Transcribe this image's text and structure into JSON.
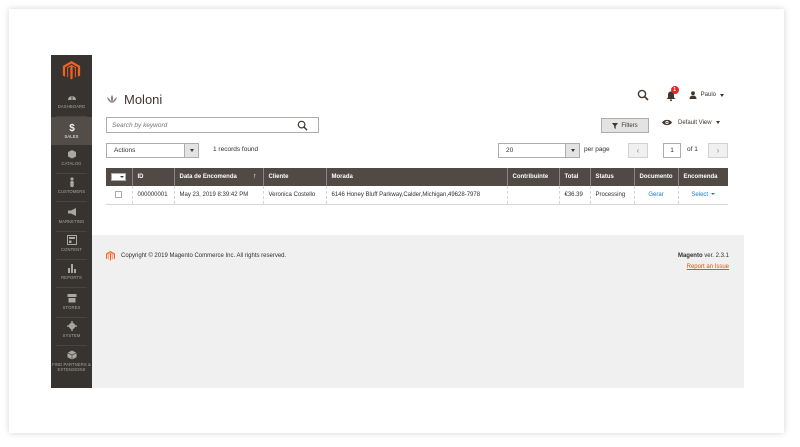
{
  "nav": [
    {
      "label": "DASHBOARD",
      "icon": "dashboard-icon"
    },
    {
      "label": "SALES",
      "icon": "dollar-icon"
    },
    {
      "label": "CATALOG",
      "icon": "cube-icon"
    },
    {
      "label": "CUSTOMERS",
      "icon": "person-icon"
    },
    {
      "label": "MARKETING",
      "icon": "megaphone-icon"
    },
    {
      "label": "CONTENT",
      "icon": "layout-icon"
    },
    {
      "label": "REPORTS",
      "icon": "bar-chart-icon"
    },
    {
      "label": "STORES",
      "icon": "store-icon"
    },
    {
      "label": "SYSTEM",
      "icon": "gear-icon"
    },
    {
      "label": "FIND PARTNERS & EXTENSIONS",
      "icon": "box-icon"
    }
  ],
  "header": {
    "title": "Moloni",
    "notifications_count": "1",
    "user_name": "Paulo"
  },
  "toolbar": {
    "search_placeholder": "Search by keyword",
    "filters_label": "Filters",
    "view_label": "Default View",
    "actions_label": "Actions",
    "records_found": "1 records found",
    "per_page_value": "20",
    "per_page_label": "per page",
    "page_current": "1",
    "page_of": "of 1"
  },
  "grid": {
    "columns": [
      "ID",
      "Data de Encomenda",
      "Cliente",
      "Morada",
      "Contribuinte",
      "Total",
      "Status",
      "Documento",
      "Encomenda"
    ],
    "rows": [
      {
        "id": "000000001",
        "date": "May 23, 2019 8:39:42 PM",
        "client": "Veronica Costello",
        "address": "6146 Honey Bluff Parkway,Calder,Michigan,49628-7978",
        "nif": "",
        "total": "€36.39",
        "status": "Processing",
        "document": "Gerar",
        "order": "Select"
      }
    ]
  },
  "footer": {
    "copyright": "Copyright © 2019 Magento Commerce Inc. All rights reserved.",
    "brand": "Magento",
    "version": " ver. 2.3.1",
    "report": "Report an Issue"
  },
  "colors": {
    "sidebar": "#373330",
    "grid_header": "#514943",
    "accent": "#eb5202",
    "link": "#1979c3"
  }
}
